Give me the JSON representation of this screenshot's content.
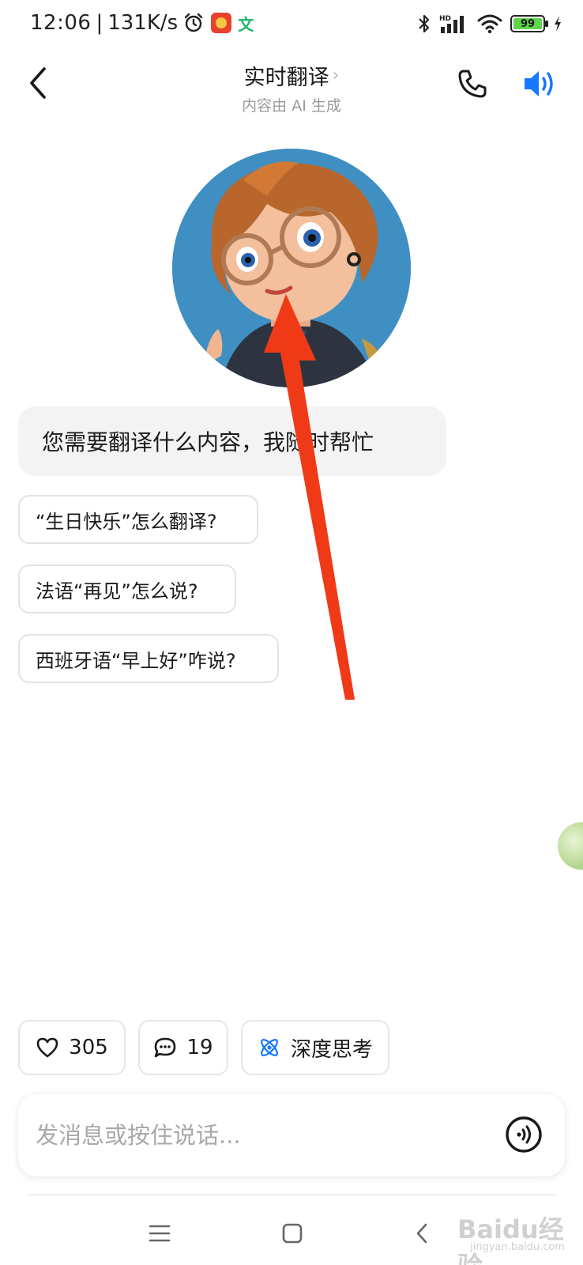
{
  "status_bar": {
    "time": "12:06",
    "separator": "|",
    "network_speed": "131K/s",
    "wen_label": "文",
    "hd_label": "HD",
    "battery": "99"
  },
  "header": {
    "title": "实时翻译",
    "title_chevron": "›",
    "subtitle": "内容由 AI 生成",
    "speaker_color": "#1677ff"
  },
  "chat": {
    "greeting": "您需要翻译什么内容，我随时帮忙",
    "suggestions": [
      "“生日快乐”怎么翻译?",
      "法语“再见”怎么说?",
      "西班牙语“早上好”咋说?"
    ]
  },
  "actions": {
    "like_count": "305",
    "comment_count": "19",
    "deep_think_label": "深度思考",
    "deep_think_color": "#1677ff"
  },
  "input": {
    "placeholder": "发消息或按住说话..."
  },
  "annotation": {
    "arrow_color": "#f03a17"
  },
  "watermark": {
    "text": "Baidu经验",
    "sub": "jingyan.baidu.com"
  }
}
